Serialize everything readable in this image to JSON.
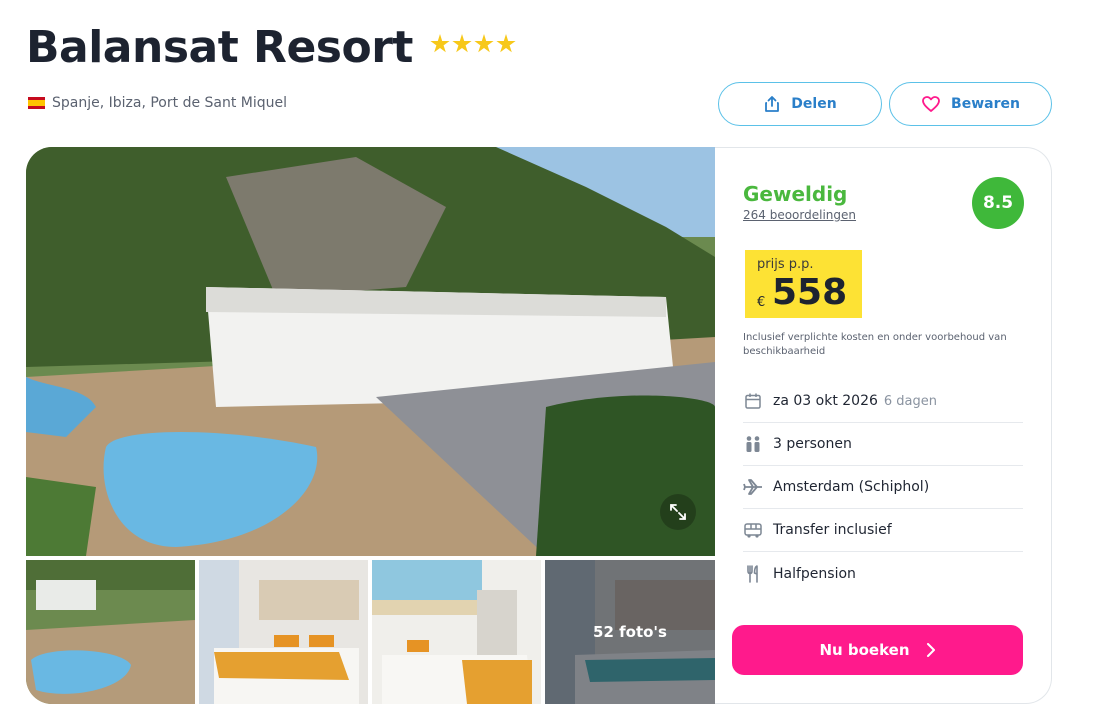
{
  "hotel": {
    "name": "Balansat Resort",
    "stars": 4,
    "location": "Spanje, Ibiza, Port de Sant Miquel"
  },
  "actions": {
    "share_label": "Delen",
    "save_label": "Bewaren"
  },
  "gallery": {
    "photo_count_label": "52 foto's"
  },
  "rating": {
    "word": "Geweldig",
    "reviews": "264 beoordelingen",
    "score": "8.5"
  },
  "price": {
    "label": "prijs p.p.",
    "currency": "€",
    "value": "558",
    "note": "Inclusief verplichte kosten en onder voorbehoud van beschikbaarheid"
  },
  "details": {
    "date": "za 03 okt 2026",
    "duration": "6 dagen",
    "persons": "3 personen",
    "departure": "Amsterdam (Schiphol)",
    "transfer": "Transfer inclusief",
    "board": "Halfpension"
  },
  "booking": {
    "button_label": "Nu boeken"
  },
  "colors": {
    "accent_pink": "#ff1a8c",
    "rating_green": "#3fb83a",
    "price_yellow": "#fde234",
    "outline_blue": "#5bc1e8"
  }
}
